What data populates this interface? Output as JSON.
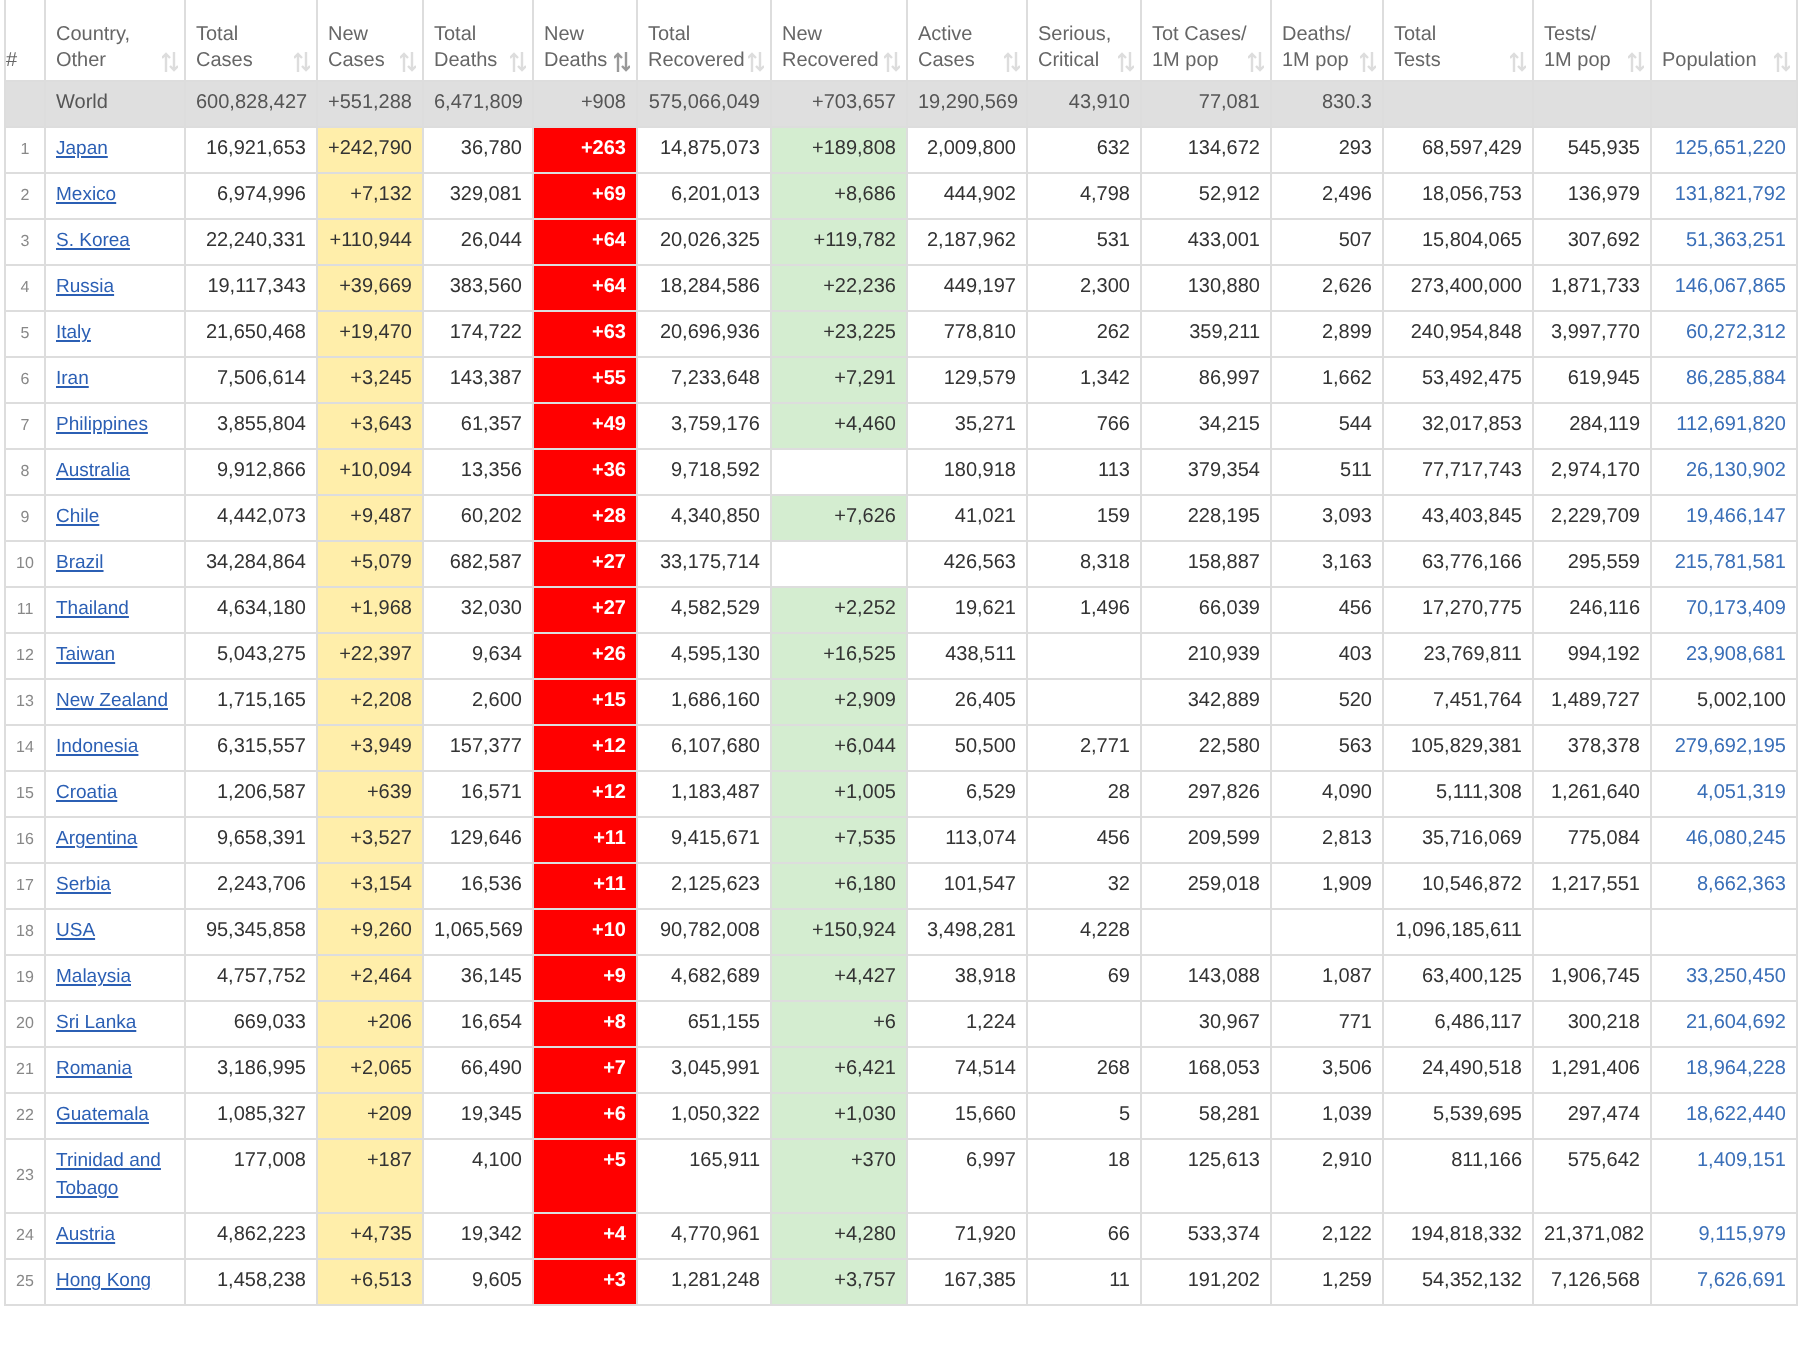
{
  "columns": [
    {
      "kind": "rank",
      "lines": [
        "#"
      ]
    },
    {
      "kind": "country",
      "lines": [
        "Country,",
        "Other"
      ],
      "sorted": false
    },
    {
      "kind": "number",
      "lines": [
        "Total",
        "Cases"
      ],
      "sorted": false
    },
    {
      "kind": "new_cases",
      "lines": [
        "New",
        "Cases"
      ],
      "sorted": false
    },
    {
      "kind": "number",
      "lines": [
        "Total",
        "Deaths"
      ],
      "sorted": false
    },
    {
      "kind": "new_deaths",
      "lines": [
        "New",
        "Deaths"
      ],
      "sorted": true
    },
    {
      "kind": "number",
      "lines": [
        "Total",
        "Recovered"
      ],
      "sorted": false
    },
    {
      "kind": "new_recovered",
      "lines": [
        "New",
        "Recovered"
      ],
      "sorted": false
    },
    {
      "kind": "number",
      "lines": [
        "Active",
        "Cases"
      ],
      "sorted": false
    },
    {
      "kind": "number",
      "lines": [
        "Serious,",
        "Critical"
      ],
      "sorted": false
    },
    {
      "kind": "number",
      "lines": [
        "Tot Cases/",
        "1M pop"
      ],
      "sorted": false
    },
    {
      "kind": "number",
      "lines": [
        "Deaths/",
        "1M pop"
      ],
      "sorted": false
    },
    {
      "kind": "number",
      "lines": [
        "Total",
        "Tests"
      ],
      "sorted": false
    },
    {
      "kind": "number",
      "lines": [
        "Tests/",
        "1M pop"
      ],
      "sorted": false
    },
    {
      "kind": "population",
      "lines": [
        "Population"
      ],
      "sorted": false
    }
  ],
  "world": {
    "country": "World",
    "total_cases": "600,828,427",
    "new_cases": "+551,288",
    "total_deaths": "6,471,809",
    "new_deaths": "+908",
    "total_recovered": "575,066,049",
    "new_recovered": "+703,657",
    "active": "19,290,569",
    "serious": "43,910",
    "cases_per_1m": "77,081",
    "deaths_per_1m": "830.3"
  },
  "rows": [
    {
      "rank": "1",
      "country": "Japan",
      "total_cases": "16,921,653",
      "new_cases": "+242,790",
      "total_deaths": "36,780",
      "new_deaths": "+263",
      "total_recovered": "14,875,073",
      "new_recovered": "+189,808",
      "active": "2,009,800",
      "serious": "632",
      "cases_per_1m": "134,672",
      "deaths_per_1m": "293",
      "tests": "68,597,429",
      "tests_per_1m": "545,935",
      "population": "125,651,220",
      "population_linked": true
    },
    {
      "rank": "2",
      "country": "Mexico",
      "total_cases": "6,974,996",
      "new_cases": "+7,132",
      "total_deaths": "329,081",
      "new_deaths": "+69",
      "total_recovered": "6,201,013",
      "new_recovered": "+8,686",
      "active": "444,902",
      "serious": "4,798",
      "cases_per_1m": "52,912",
      "deaths_per_1m": "2,496",
      "tests": "18,056,753",
      "tests_per_1m": "136,979",
      "population": "131,821,792",
      "population_linked": true
    },
    {
      "rank": "3",
      "country": "S. Korea",
      "total_cases": "22,240,331",
      "new_cases": "+110,944",
      "total_deaths": "26,044",
      "new_deaths": "+64",
      "total_recovered": "20,026,325",
      "new_recovered": "+119,782",
      "active": "2,187,962",
      "serious": "531",
      "cases_per_1m": "433,001",
      "deaths_per_1m": "507",
      "tests": "15,804,065",
      "tests_per_1m": "307,692",
      "population": "51,363,251",
      "population_linked": true
    },
    {
      "rank": "4",
      "country": "Russia",
      "total_cases": "19,117,343",
      "new_cases": "+39,669",
      "total_deaths": "383,560",
      "new_deaths": "+64",
      "total_recovered": "18,284,586",
      "new_recovered": "+22,236",
      "active": "449,197",
      "serious": "2,300",
      "cases_per_1m": "130,880",
      "deaths_per_1m": "2,626",
      "tests": "273,400,000",
      "tests_per_1m": "1,871,733",
      "population": "146,067,865",
      "population_linked": true
    },
    {
      "rank": "5",
      "country": "Italy",
      "total_cases": "21,650,468",
      "new_cases": "+19,470",
      "total_deaths": "174,722",
      "new_deaths": "+63",
      "total_recovered": "20,696,936",
      "new_recovered": "+23,225",
      "active": "778,810",
      "serious": "262",
      "cases_per_1m": "359,211",
      "deaths_per_1m": "2,899",
      "tests": "240,954,848",
      "tests_per_1m": "3,997,770",
      "population": "60,272,312",
      "population_linked": true
    },
    {
      "rank": "6",
      "country": "Iran",
      "total_cases": "7,506,614",
      "new_cases": "+3,245",
      "total_deaths": "143,387",
      "new_deaths": "+55",
      "total_recovered": "7,233,648",
      "new_recovered": "+7,291",
      "active": "129,579",
      "serious": "1,342",
      "cases_per_1m": "86,997",
      "deaths_per_1m": "1,662",
      "tests": "53,492,475",
      "tests_per_1m": "619,945",
      "population": "86,285,884",
      "population_linked": true
    },
    {
      "rank": "7",
      "country": "Philippines",
      "total_cases": "3,855,804",
      "new_cases": "+3,643",
      "total_deaths": "61,357",
      "new_deaths": "+49",
      "total_recovered": "3,759,176",
      "new_recovered": "+4,460",
      "active": "35,271",
      "serious": "766",
      "cases_per_1m": "34,215",
      "deaths_per_1m": "544",
      "tests": "32,017,853",
      "tests_per_1m": "284,119",
      "population": "112,691,820",
      "population_linked": true
    },
    {
      "rank": "8",
      "country": "Australia",
      "total_cases": "9,912,866",
      "new_cases": "+10,094",
      "total_deaths": "13,356",
      "new_deaths": "+36",
      "total_recovered": "9,718,592",
      "active": "180,918",
      "serious": "113",
      "cases_per_1m": "379,354",
      "deaths_per_1m": "511",
      "tests": "77,717,743",
      "tests_per_1m": "2,974,170",
      "population": "26,130,902",
      "population_linked": true
    },
    {
      "rank": "9",
      "country": "Chile",
      "total_cases": "4,442,073",
      "new_cases": "+9,487",
      "total_deaths": "60,202",
      "new_deaths": "+28",
      "total_recovered": "4,340,850",
      "new_recovered": "+7,626",
      "active": "41,021",
      "serious": "159",
      "cases_per_1m": "228,195",
      "deaths_per_1m": "3,093",
      "tests": "43,403,845",
      "tests_per_1m": "2,229,709",
      "population": "19,466,147",
      "population_linked": true
    },
    {
      "rank": "10",
      "country": "Brazil",
      "total_cases": "34,284,864",
      "new_cases": "+5,079",
      "total_deaths": "682,587",
      "new_deaths": "+27",
      "total_recovered": "33,175,714",
      "active": "426,563",
      "serious": "8,318",
      "cases_per_1m": "158,887",
      "deaths_per_1m": "3,163",
      "tests": "63,776,166",
      "tests_per_1m": "295,559",
      "population": "215,781,581",
      "population_linked": true
    },
    {
      "rank": "11",
      "country": "Thailand",
      "total_cases": "4,634,180",
      "new_cases": "+1,968",
      "total_deaths": "32,030",
      "new_deaths": "+27",
      "total_recovered": "4,582,529",
      "new_recovered": "+2,252",
      "active": "19,621",
      "serious": "1,496",
      "cases_per_1m": "66,039",
      "deaths_per_1m": "456",
      "tests": "17,270,775",
      "tests_per_1m": "246,116",
      "population": "70,173,409",
      "population_linked": true
    },
    {
      "rank": "12",
      "country": "Taiwan",
      "total_cases": "5,043,275",
      "new_cases": "+22,397",
      "total_deaths": "9,634",
      "new_deaths": "+26",
      "total_recovered": "4,595,130",
      "new_recovered": "+16,525",
      "active": "438,511",
      "cases_per_1m": "210,939",
      "deaths_per_1m": "403",
      "tests": "23,769,811",
      "tests_per_1m": "994,192",
      "population": "23,908,681",
      "population_linked": true
    },
    {
      "rank": "13",
      "country": "New Zealand",
      "total_cases": "1,715,165",
      "new_cases": "+2,208",
      "total_deaths": "2,600",
      "new_deaths": "+15",
      "total_recovered": "1,686,160",
      "new_recovered": "+2,909",
      "active": "26,405",
      "cases_per_1m": "342,889",
      "deaths_per_1m": "520",
      "tests": "7,451,764",
      "tests_per_1m": "1,489,727",
      "population": "5,002,100",
      "population_linked": false
    },
    {
      "rank": "14",
      "country": "Indonesia",
      "total_cases": "6,315,557",
      "new_cases": "+3,949",
      "total_deaths": "157,377",
      "new_deaths": "+12",
      "total_recovered": "6,107,680",
      "new_recovered": "+6,044",
      "active": "50,500",
      "serious": "2,771",
      "cases_per_1m": "22,580",
      "deaths_per_1m": "563",
      "tests": "105,829,381",
      "tests_per_1m": "378,378",
      "population": "279,692,195",
      "population_linked": true
    },
    {
      "rank": "15",
      "country": "Croatia",
      "total_cases": "1,206,587",
      "new_cases": "+639",
      "total_deaths": "16,571",
      "new_deaths": "+12",
      "total_recovered": "1,183,487",
      "new_recovered": "+1,005",
      "active": "6,529",
      "serious": "28",
      "cases_per_1m": "297,826",
      "deaths_per_1m": "4,090",
      "tests": "5,111,308",
      "tests_per_1m": "1,261,640",
      "population": "4,051,319",
      "population_linked": true
    },
    {
      "rank": "16",
      "country": "Argentina",
      "total_cases": "9,658,391",
      "new_cases": "+3,527",
      "total_deaths": "129,646",
      "new_deaths": "+11",
      "total_recovered": "9,415,671",
      "new_recovered": "+7,535",
      "active": "113,074",
      "serious": "456",
      "cases_per_1m": "209,599",
      "deaths_per_1m": "2,813",
      "tests": "35,716,069",
      "tests_per_1m": "775,084",
      "population": "46,080,245",
      "population_linked": true
    },
    {
      "rank": "17",
      "country": "Serbia",
      "total_cases": "2,243,706",
      "new_cases": "+3,154",
      "total_deaths": "16,536",
      "new_deaths": "+11",
      "total_recovered": "2,125,623",
      "new_recovered": "+6,180",
      "active": "101,547",
      "serious": "32",
      "cases_per_1m": "259,018",
      "deaths_per_1m": "1,909",
      "tests": "10,546,872",
      "tests_per_1m": "1,217,551",
      "population": "8,662,363",
      "population_linked": true
    },
    {
      "rank": "18",
      "country": "USA",
      "total_cases": "95,345,858",
      "new_cases": "+9,260",
      "total_deaths": "1,065,569",
      "new_deaths": "+10",
      "total_recovered": "90,782,008",
      "new_recovered": "+150,924",
      "active": "3,498,281",
      "serious": "4,228",
      "tests": "1,096,185,611"
    },
    {
      "rank": "19",
      "country": "Malaysia",
      "total_cases": "4,757,752",
      "new_cases": "+2,464",
      "total_deaths": "36,145",
      "new_deaths": "+9",
      "total_recovered": "4,682,689",
      "new_recovered": "+4,427",
      "active": "38,918",
      "serious": "69",
      "cases_per_1m": "143,088",
      "deaths_per_1m": "1,087",
      "tests": "63,400,125",
      "tests_per_1m": "1,906,745",
      "population": "33,250,450",
      "population_linked": true
    },
    {
      "rank": "20",
      "country": "Sri Lanka",
      "total_cases": "669,033",
      "new_cases": "+206",
      "total_deaths": "16,654",
      "new_deaths": "+8",
      "total_recovered": "651,155",
      "new_recovered": "+6",
      "active": "1,224",
      "cases_per_1m": "30,967",
      "deaths_per_1m": "771",
      "tests": "6,486,117",
      "tests_per_1m": "300,218",
      "population": "21,604,692",
      "population_linked": true
    },
    {
      "rank": "21",
      "country": "Romania",
      "total_cases": "3,186,995",
      "new_cases": "+2,065",
      "total_deaths": "66,490",
      "new_deaths": "+7",
      "total_recovered": "3,045,991",
      "new_recovered": "+6,421",
      "active": "74,514",
      "serious": "268",
      "cases_per_1m": "168,053",
      "deaths_per_1m": "3,506",
      "tests": "24,490,518",
      "tests_per_1m": "1,291,406",
      "population": "18,964,228",
      "population_linked": true
    },
    {
      "rank": "22",
      "country": "Guatemala",
      "total_cases": "1,085,327",
      "new_cases": "+209",
      "total_deaths": "19,345",
      "new_deaths": "+6",
      "total_recovered": "1,050,322",
      "new_recovered": "+1,030",
      "active": "15,660",
      "serious": "5",
      "cases_per_1m": "58,281",
      "deaths_per_1m": "1,039",
      "tests": "5,539,695",
      "tests_per_1m": "297,474",
      "population": "18,622,440",
      "population_linked": true
    },
    {
      "rank": "23",
      "country": "Trinidad and Tobago",
      "total_cases": "177,008",
      "new_cases": "+187",
      "total_deaths": "4,100",
      "new_deaths": "+5",
      "total_recovered": "165,911",
      "new_recovered": "+370",
      "active": "6,997",
      "serious": "18",
      "cases_per_1m": "125,613",
      "deaths_per_1m": "2,910",
      "tests": "811,166",
      "tests_per_1m": "575,642",
      "population": "1,409,151",
      "population_linked": true
    },
    {
      "rank": "24",
      "country": "Austria",
      "total_cases": "4,862,223",
      "new_cases": "+4,735",
      "total_deaths": "19,342",
      "new_deaths": "+4",
      "total_recovered": "4,770,961",
      "new_recovered": "+4,280",
      "active": "71,920",
      "serious": "66",
      "cases_per_1m": "533,374",
      "deaths_per_1m": "2,122",
      "tests": "194,818,332",
      "tests_per_1m": "21,371,082",
      "population": "9,115,979",
      "population_linked": true
    },
    {
      "rank": "25",
      "country": "Hong Kong",
      "total_cases": "1,458,238",
      "new_cases": "+6,513",
      "total_deaths": "9,605",
      "new_deaths": "+3",
      "total_recovered": "1,281,248",
      "new_recovered": "+3,757",
      "active": "167,385",
      "serious": "11",
      "cases_per_1m": "191,202",
      "deaths_per_1m": "1,259",
      "tests": "54,352,132",
      "tests_per_1m": "7,126,568",
      "population": "7,626,691",
      "population_linked": true
    }
  ]
}
